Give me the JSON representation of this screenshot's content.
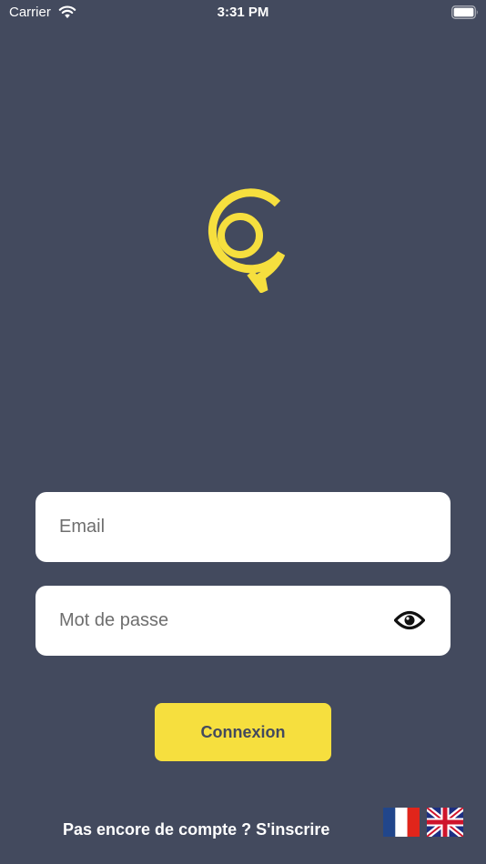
{
  "status_bar": {
    "carrier": "Carrier",
    "time": "3:31 PM"
  },
  "icons": {
    "logo": "app-logo-yellow-ring",
    "wifi": "wifi-icon",
    "battery": "battery-icon",
    "eye": "eye-icon",
    "flag_fr": "flag-fr-icon",
    "flag_uk": "flag-uk-icon"
  },
  "login_form": {
    "email_placeholder": "Email",
    "email_value": "",
    "password_placeholder": "Mot de passe",
    "password_value": "",
    "submit_label": "Connexion"
  },
  "footer": {
    "signup_text": "Pas encore de compte ? S'inscrire"
  },
  "colors": {
    "background": "#434a5e",
    "accent": "#f6df3e",
    "field_background": "#ffffff"
  }
}
